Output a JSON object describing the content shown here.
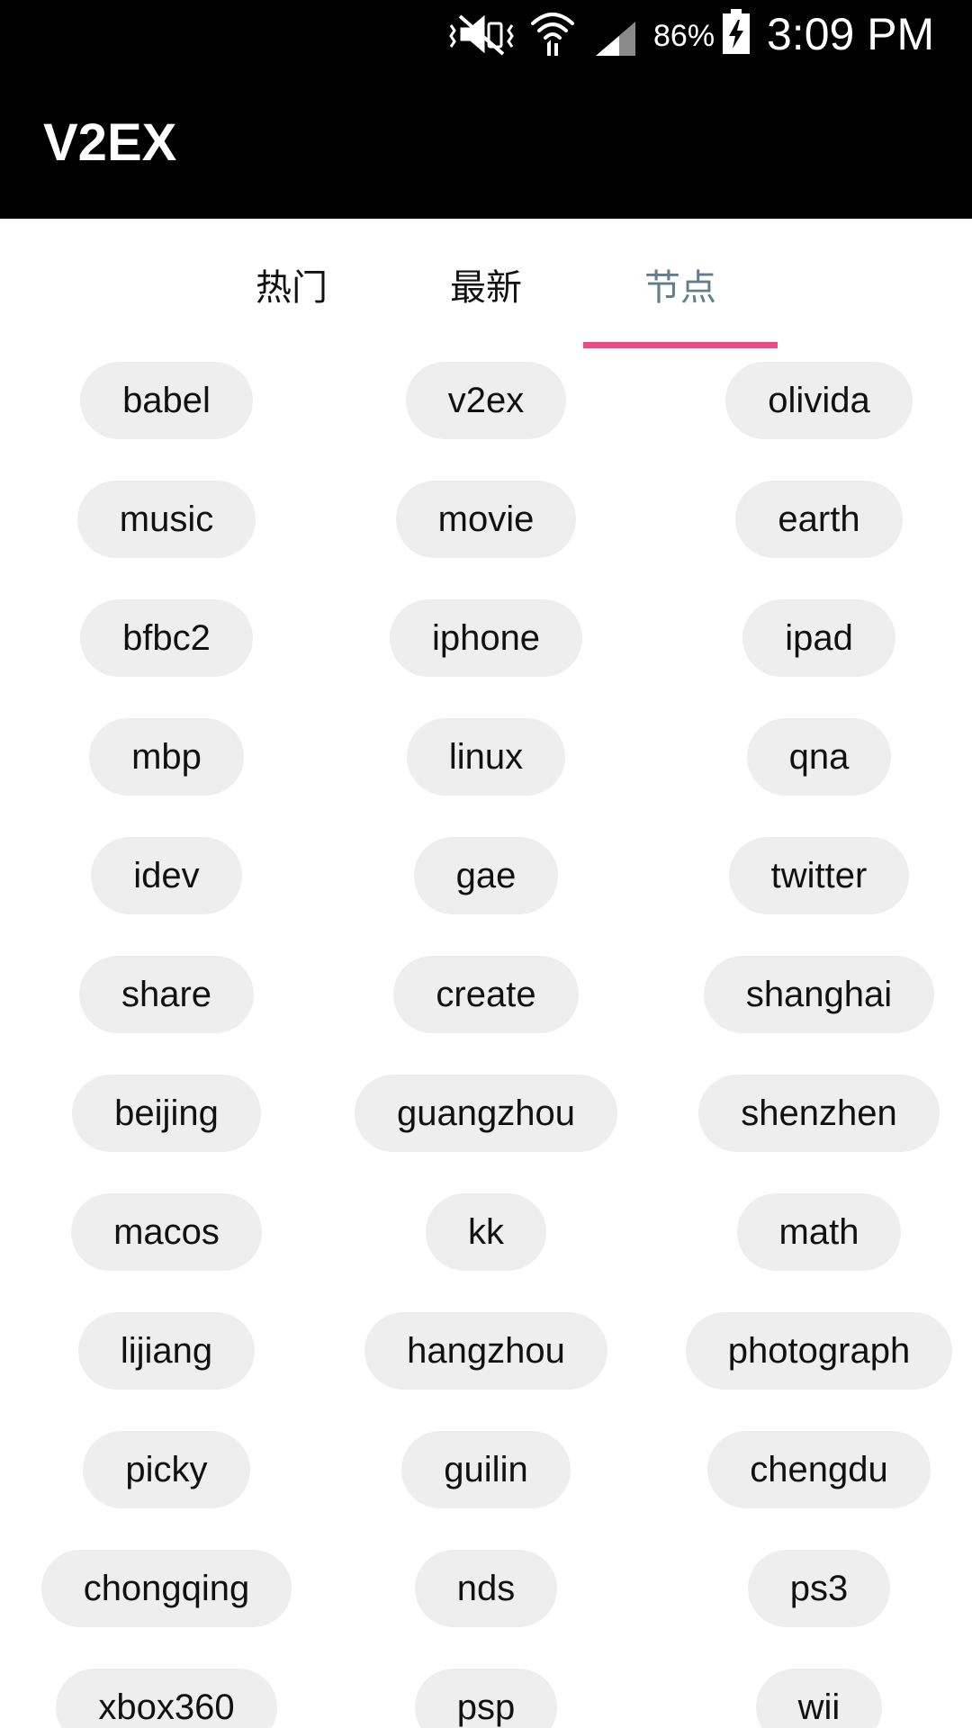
{
  "status_bar": {
    "battery_percent": "86%",
    "time": "3:09 PM",
    "icons": [
      "mute-vibrate-icon",
      "wifi-icon",
      "cell-signal-icon",
      "battery-charging-icon"
    ]
  },
  "app_bar": {
    "title": "V2EX"
  },
  "tabs": [
    {
      "label": "热门",
      "selected": false
    },
    {
      "label": "最新",
      "selected": false
    },
    {
      "label": "节点",
      "selected": true
    }
  ],
  "colors": {
    "bar_background": "#000000",
    "tab_selected_text": "#617e8f",
    "tab_indicator": "#ef4a86",
    "chip_background": "#eeeeee"
  },
  "nodes": [
    [
      "babel",
      "v2ex",
      "olivida"
    ],
    [
      "music",
      "movie",
      "earth"
    ],
    [
      "bfbc2",
      "iphone",
      "ipad"
    ],
    [
      "mbp",
      "linux",
      "qna"
    ],
    [
      "idev",
      "gae",
      "twitter"
    ],
    [
      "share",
      "create",
      "shanghai"
    ],
    [
      "beijing",
      "guangzhou",
      "shenzhen"
    ],
    [
      "macos",
      "kk",
      "math"
    ],
    [
      "lijiang",
      "hangzhou",
      "photograph"
    ],
    [
      "picky",
      "guilin",
      "chengdu"
    ],
    [
      "chongqing",
      "nds",
      "ps3"
    ],
    [
      "xbox360",
      "psp",
      "wii"
    ]
  ]
}
